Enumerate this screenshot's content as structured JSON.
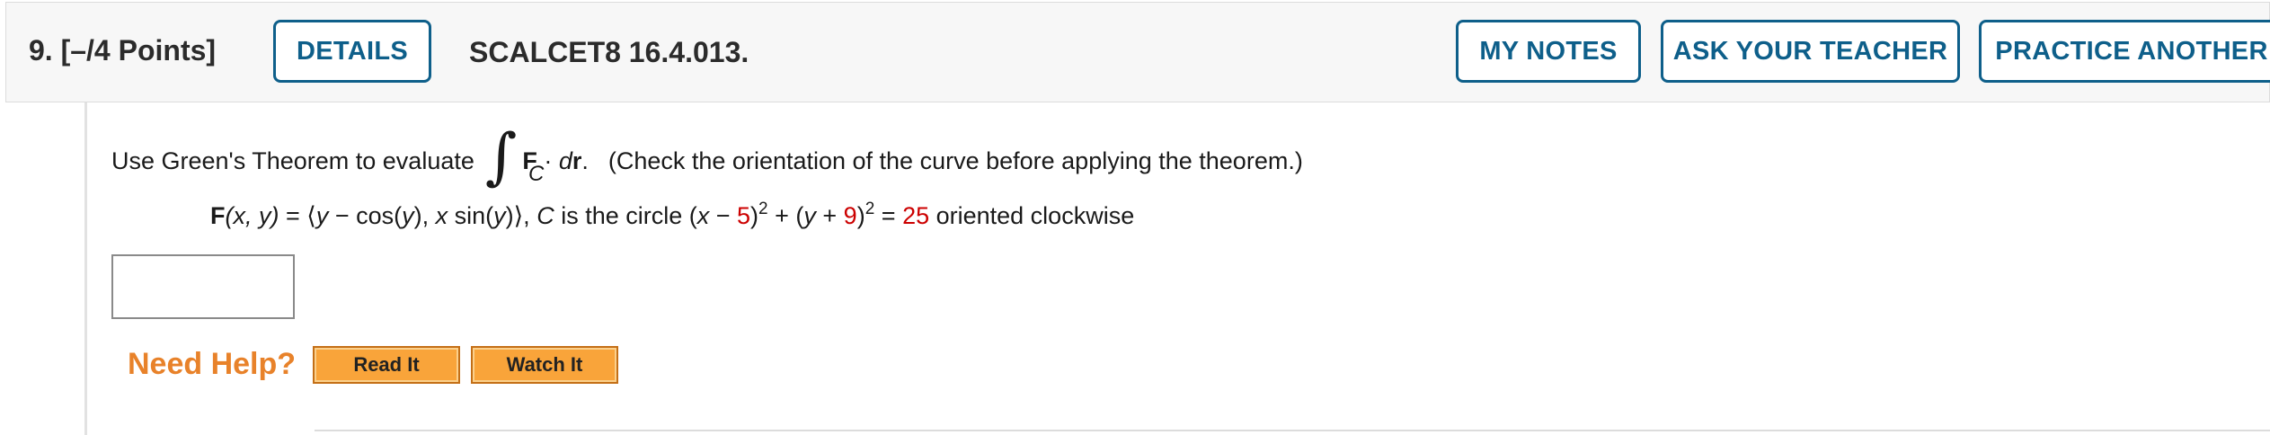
{
  "header": {
    "question_label": "9.  [–/4 Points]",
    "details_label": "DETAILS",
    "code": "SCALCET8 16.4.013.",
    "my_notes_label": "MY NOTES",
    "ask_teacher_label": "ASK YOUR TEACHER",
    "practice_another_label": "PRACTICE ANOTHER"
  },
  "question": {
    "prompt_prefix": "Use Green's Theorem to evaluate",
    "integral_symbol": "∫",
    "integral_subscript": "C",
    "integrand_F": "F",
    "integrand_dot": " · ",
    "integrand_d": "d",
    "integrand_r": "r",
    "integrand_period": ".",
    "prompt_suffix": "(Check the orientation of the curve before applying the theorem.)",
    "formula": {
      "F_label": "F",
      "args": "(x, y)",
      "eq": " = ",
      "lang": "⟨",
      "y": "y",
      "minus_cos": " − cos(",
      "y2": "y",
      "close_comma": "), ",
      "x": "x",
      "sin": " sin(",
      "y3": "y",
      "close_paren": ")",
      "rang": "⟩",
      "comma": ", ",
      "C": "C",
      "is_circle": " is the circle (",
      "x2": "x",
      "minus": " − ",
      "h": "5",
      "close1": ")",
      "exp1": "2",
      "plus": " + (",
      "y4": "y",
      "plus2": " + ",
      "k": "9",
      "close2": ")",
      "exp2": "2",
      "eq2": " = ",
      "r2": "25",
      "orientation": " oriented clockwise"
    }
  },
  "help": {
    "need_help_label": "Need Help?",
    "read_it_label": "Read It",
    "watch_it_label": "Watch It"
  },
  "colors": {
    "button_blue": "#0e5f8a",
    "given_value_red": "#cc0000",
    "need_help_orange": "#e8822a",
    "help_button_orange": "#f9a43a"
  }
}
